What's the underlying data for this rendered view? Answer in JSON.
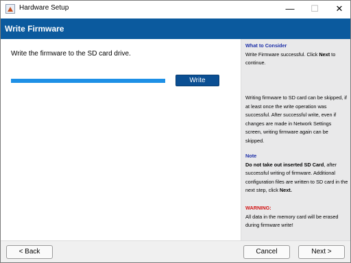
{
  "window": {
    "title": "Hardware Setup",
    "minimize": "—",
    "maximize": "☐",
    "close": "✕"
  },
  "header": {
    "title": "Write Firmware"
  },
  "main": {
    "instruction": "Write the firmware to the SD card drive.",
    "progress": 1.0,
    "write_label": "Write"
  },
  "side": {
    "consider_heading": "What to Consider",
    "success_pre": "Write Firmware successful. Click ",
    "success_bold": "Next",
    "success_post": " to continue.",
    "skip_text": "Writing firmware to SD card can be skipped, if at least once the write operation was successful. After successful write, even if changes are made in Network Settings screen, writing firmware again can be skipped.",
    "note_heading": "Note",
    "note_bold": "Do not take out inserted SD Card",
    "note_pre": ", after successful writing of firmware. Additional configuration files are written to SD card in the next step, click ",
    "note_next": "Next.",
    "warning_heading": "WARNING:",
    "warning_text": "All data in the memory card will be erased during firmware write!"
  },
  "footer": {
    "back_label": "< Back",
    "cancel_label": "Cancel",
    "next_label": "Next >"
  },
  "colors": {
    "header_bg": "#0b5a9e",
    "progress": "#1e90e6",
    "write_button": "#0b4f93",
    "heading": "#1d2fa8",
    "warning": "#d21414"
  }
}
